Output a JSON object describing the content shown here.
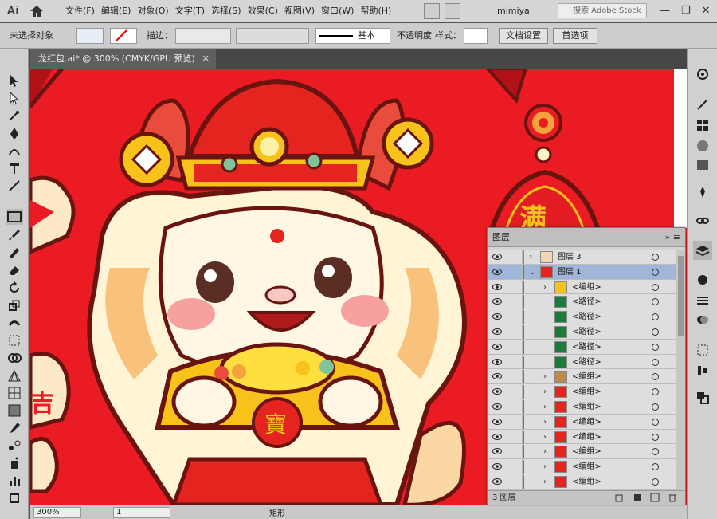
{
  "app": {
    "logo": "Ai",
    "user": "mimiya",
    "stock_placeholder": "搜索 Adobe Stock"
  },
  "menus": [
    "文件(F)",
    "编辑(E)",
    "对象(O)",
    "文字(T)",
    "选择(S)",
    "效果(C)",
    "视图(V)",
    "窗口(W)",
    "帮助(H)"
  ],
  "window_controls": [
    "—",
    "❐",
    "✕"
  ],
  "control_bar": {
    "selection": "未选择对象",
    "stroke_label": "描边：",
    "stroke_style": "基本",
    "opacity_label": "不透明度",
    "style_label": "样式：",
    "doc_settings": "文档设置",
    "preferences": "首选项"
  },
  "document_tab": {
    "title": "龙红包.ai* @ 300% (CMYK/GPU 预览)",
    "close": "✕"
  },
  "status_bar": {
    "zoom": "300%",
    "page": "1",
    "mode": "矩形"
  },
  "layers_panel": {
    "title": "图层",
    "footer": "3 图层",
    "rows": [
      {
        "name": "图层 3",
        "arrow": "›",
        "indent": 0,
        "selected": false
      },
      {
        "name": "图层 1",
        "arrow": "⌄",
        "indent": 0,
        "selected": true
      },
      {
        "name": "<编组>",
        "arrow": "›",
        "indent": 1,
        "selected": false
      },
      {
        "name": "<路径>",
        "arrow": "",
        "indent": 1,
        "selected": false
      },
      {
        "name": "<路径>",
        "arrow": "",
        "indent": 1,
        "selected": false
      },
      {
        "name": "<路径>",
        "arrow": "",
        "indent": 1,
        "selected": false
      },
      {
        "name": "<路径>",
        "arrow": "",
        "indent": 1,
        "selected": false
      },
      {
        "name": "<路径>",
        "arrow": "",
        "indent": 1,
        "selected": false
      },
      {
        "name": "<编组>",
        "arrow": "›",
        "indent": 1,
        "selected": false
      },
      {
        "name": "<编组>",
        "arrow": "›",
        "indent": 1,
        "selected": false
      },
      {
        "name": "<编组>",
        "arrow": "›",
        "indent": 1,
        "selected": false
      },
      {
        "name": "<编组>",
        "arrow": "›",
        "indent": 1,
        "selected": false
      },
      {
        "name": "<编组>",
        "arrow": "›",
        "indent": 1,
        "selected": false
      },
      {
        "name": "<编组>",
        "arrow": "›",
        "indent": 1,
        "selected": false
      },
      {
        "name": "<编组>",
        "arrow": "›",
        "indent": 1,
        "selected": false
      },
      {
        "name": "<编组>",
        "arrow": "›",
        "indent": 1,
        "selected": false
      }
    ]
  },
  "artwork": {
    "seal_text": "寶",
    "banner_text": "满",
    "side_text": "吉"
  },
  "colors": {
    "canvas_red": "#ea1b22",
    "gold": "#f7c21a",
    "cream": "#fde9c6",
    "outline": "#6a1410",
    "selected_row": "#9fb6d8"
  }
}
